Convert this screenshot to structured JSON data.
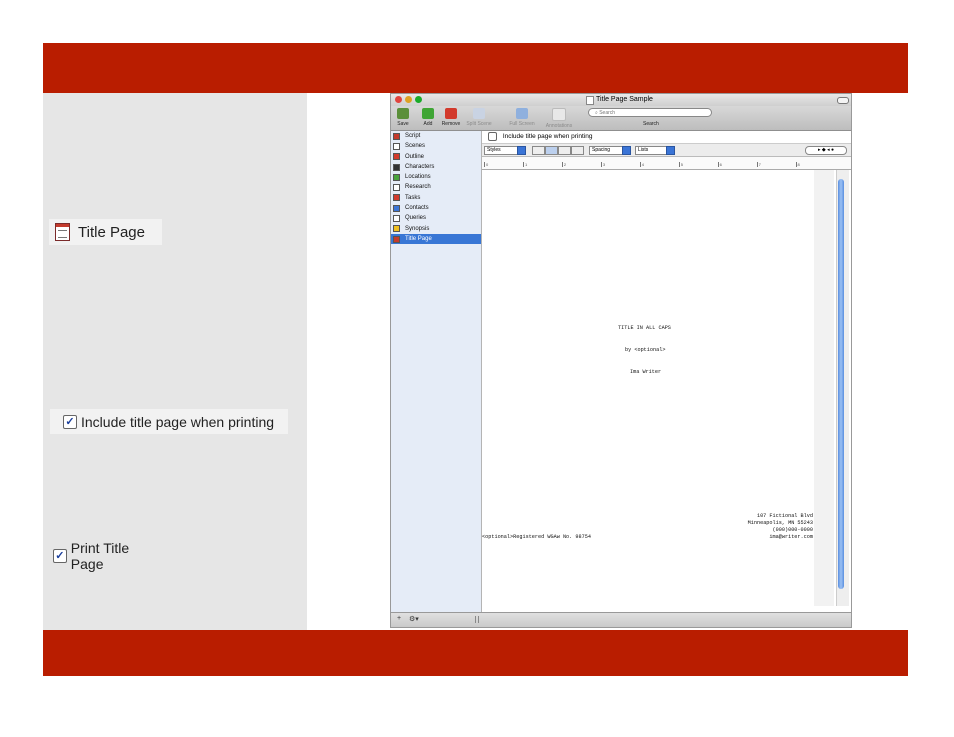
{
  "colors": {
    "banner": "#b91d00",
    "left_panel": "#e6e6e6",
    "selection": "#3876d5"
  },
  "callouts": {
    "title_page": "Title Page",
    "include_label": "Include title page when printing",
    "print_label": "Print Title Page"
  },
  "window": {
    "title": "Title Page Sample",
    "toolbar": {
      "save": "Save",
      "add": "Add",
      "remove": "Remove",
      "split_scene": "Split Scene",
      "full_screen": "Full Screen",
      "annotations": "Annotations",
      "search_placeholder": "Search",
      "search_label": "Search"
    },
    "sidebar": [
      {
        "label": "Script",
        "icon": "script-icon"
      },
      {
        "label": "Scenes",
        "icon": "scenes-icon"
      },
      {
        "label": "Outline",
        "icon": "outline-icon"
      },
      {
        "label": "Characters",
        "icon": "characters-icon"
      },
      {
        "label": "Locations",
        "icon": "locations-icon"
      },
      {
        "label": "Research",
        "icon": "research-icon"
      },
      {
        "label": "Tasks",
        "icon": "tasks-icon"
      },
      {
        "label": "Contacts",
        "icon": "contacts-icon"
      },
      {
        "label": "Queries",
        "icon": "queries-icon"
      },
      {
        "label": "Synopsis",
        "icon": "synopsis-icon"
      },
      {
        "label": "Title Page",
        "icon": "title-page-icon",
        "selected": true
      }
    ],
    "include_checkbox_label": "Include title page when printing",
    "format": {
      "styles": "Styles",
      "spacing": "Spacing",
      "lists": "Lists"
    },
    "ruler_ticks": [
      "0",
      "1",
      "2",
      "3",
      "4",
      "5",
      "6",
      "7",
      "8"
    ],
    "page": {
      "title": "TITLE IN ALL CAPS",
      "by_line": "by <optional>",
      "author": "Ima Writer",
      "address_1": "107 Fictional Blvd",
      "address_2": "Minneapolis, MN 55243",
      "phone": "(000)000-0000",
      "email": "ima@writer.com",
      "registration": "<optional>Registered WGAw No. 98754"
    },
    "bottom": {
      "add": "+",
      "gear": "⚙▾"
    }
  }
}
